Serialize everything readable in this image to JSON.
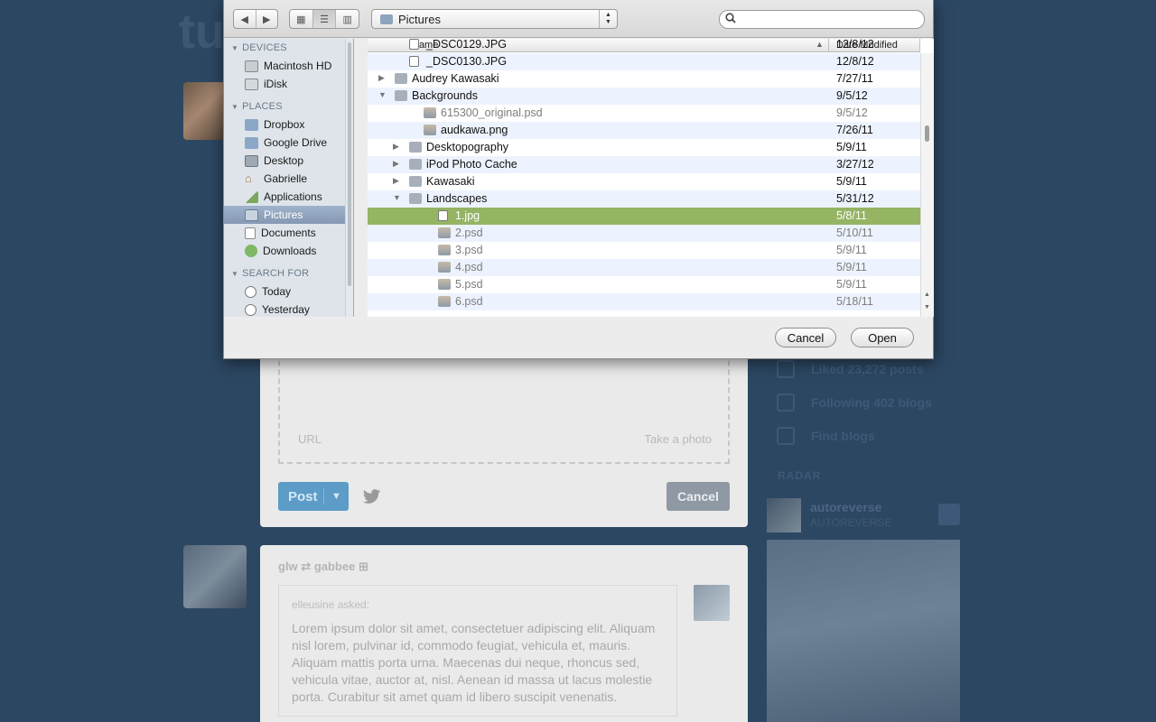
{
  "background": {
    "logo": "tu",
    "editor": {
      "url_label": "URL",
      "photo_label": "Take a photo",
      "post_label": "Post",
      "cancel_label": "Cancel"
    },
    "reblog": {
      "from": "glw",
      "to": "gabbee",
      "asker": "elleusine asked:",
      "question": "Lorem ipsum dolor sit amet, consectetuer adipiscing elit. Aliquam nisl lorem, pulvinar id, commodo feugiat, vehicula et, mauris. Aliquam mattis porta urna. Maecenas dui neque, rhoncus sed, vehicula vitae, auctor at, nisl. Aenean id massa ut lacus molestie porta. Curabitur sit amet quam id libero suscipit venenatis."
    },
    "sidebar": [
      {
        "label": "Liked 23,272 posts"
      },
      {
        "label": "Following 402 blogs"
      },
      {
        "label": "Find blogs"
      }
    ],
    "radar": {
      "label": "RADAR",
      "blog_name": "autoreverse",
      "blog_sub": "AUTOREVERSE"
    }
  },
  "dialog": {
    "location": "Pictures",
    "search_placeholder": "",
    "columns": {
      "name": "Name",
      "date": "Date Modified"
    },
    "sidebar": {
      "sections": [
        {
          "title": "DEVICES",
          "items": [
            {
              "label": "Macintosh HD",
              "icon": "hard-drive-icon"
            },
            {
              "label": "iDisk",
              "icon": "idisk-icon"
            }
          ]
        },
        {
          "title": "PLACES",
          "items": [
            {
              "label": "Dropbox",
              "icon": "dropbox-icon"
            },
            {
              "label": "Google Drive",
              "icon": "google-drive-icon"
            },
            {
              "label": "Desktop",
              "icon": "desktop-icon"
            },
            {
              "label": "Gabrielle",
              "icon": "home-icon"
            },
            {
              "label": "Applications",
              "icon": "applications-icon"
            },
            {
              "label": "Pictures",
              "icon": "pictures-icon",
              "selected": true
            },
            {
              "label": "Documents",
              "icon": "documents-icon"
            },
            {
              "label": "Downloads",
              "icon": "downloads-icon"
            }
          ]
        },
        {
          "title": "SEARCH FOR",
          "items": [
            {
              "label": "Today",
              "icon": "clock-icon"
            },
            {
              "label": "Yesterday",
              "icon": "clock-icon"
            }
          ]
        }
      ]
    },
    "files": [
      {
        "name": "_DSC0129.JPG",
        "date": "12/8/12",
        "level": 1,
        "kind": "file"
      },
      {
        "name": "_DSC0130.JPG",
        "date": "12/8/12",
        "level": 1,
        "kind": "file"
      },
      {
        "name": "Audrey Kawasaki",
        "date": "7/27/11",
        "level": 0,
        "kind": "folder",
        "disclosure": "closed"
      },
      {
        "name": "Backgrounds",
        "date": "9/5/12",
        "level": 0,
        "kind": "folder",
        "disclosure": "open"
      },
      {
        "name": "615300_original.psd",
        "date": "9/5/12",
        "level": 2,
        "kind": "image",
        "dim": true
      },
      {
        "name": "audkawa.png",
        "date": "7/26/11",
        "level": 2,
        "kind": "image"
      },
      {
        "name": "Desktopography",
        "date": "5/9/11",
        "level": 1,
        "kind": "folder",
        "disclosure": "closed"
      },
      {
        "name": "iPod Photo Cache",
        "date": "3/27/12",
        "level": 1,
        "kind": "folder",
        "disclosure": "closed"
      },
      {
        "name": "Kawasaki",
        "date": "5/9/11",
        "level": 1,
        "kind": "folder",
        "disclosure": "closed"
      },
      {
        "name": "Landscapes",
        "date": "5/31/12",
        "level": 1,
        "kind": "folder",
        "disclosure": "open"
      },
      {
        "name": "1.jpg",
        "date": "5/8/11",
        "level": 3,
        "kind": "file",
        "selected": true
      },
      {
        "name": "2.psd",
        "date": "5/10/11",
        "level": 3,
        "kind": "image",
        "dim": true
      },
      {
        "name": "3.psd",
        "date": "5/9/11",
        "level": 3,
        "kind": "image",
        "dim": true
      },
      {
        "name": "4.psd",
        "date": "5/9/11",
        "level": 3,
        "kind": "image",
        "dim": true
      },
      {
        "name": "5.psd",
        "date": "5/9/11",
        "level": 3,
        "kind": "image",
        "dim": true
      },
      {
        "name": "6.psd",
        "date": "5/18/11",
        "level": 3,
        "kind": "image",
        "dim": true
      }
    ],
    "buttons": {
      "cancel": "Cancel",
      "open": "Open"
    },
    "colors": {
      "selection": "#95b464",
      "sidebar_selection": "#8598b4"
    }
  }
}
